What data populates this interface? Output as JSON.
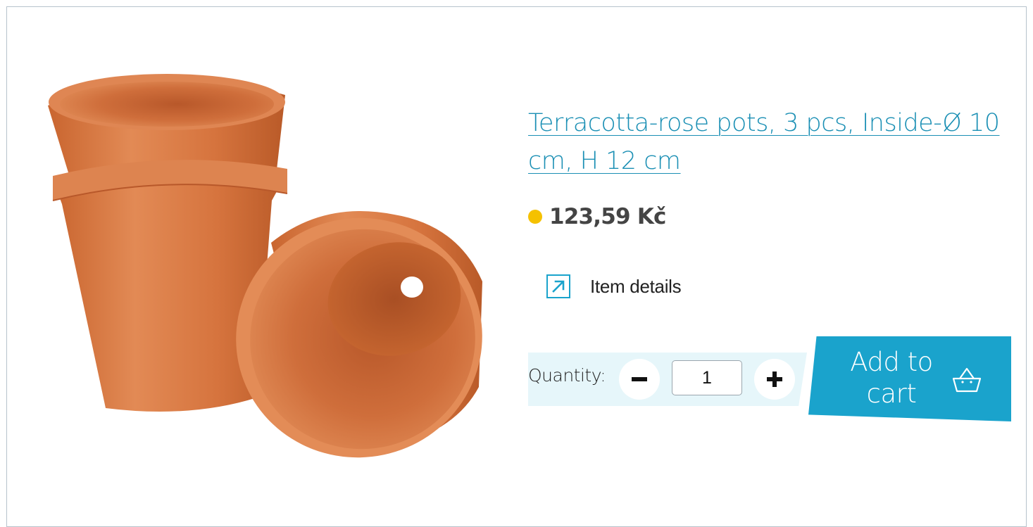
{
  "product": {
    "title": "Terracotta-rose pots, 3 pcs, Inside-Ø 10 cm, H 12 cm",
    "price": "123,59 Kč",
    "availability_color": "#f5c100",
    "image_icon": "terracotta-pots-image"
  },
  "details_link": {
    "label": "Item details",
    "icon": "external-link-arrow-icon"
  },
  "quantity": {
    "label": "Quantity:",
    "value": "1",
    "decrement_icon": "minus-icon",
    "increment_icon": "plus-icon"
  },
  "add_to_cart": {
    "label": "Add to cart",
    "icon": "basket-icon"
  },
  "colors": {
    "accent": "#1aa3cc",
    "link": "#1a8fb4",
    "quantity_background": "#e6f6fa",
    "pot": "#d97a45"
  }
}
